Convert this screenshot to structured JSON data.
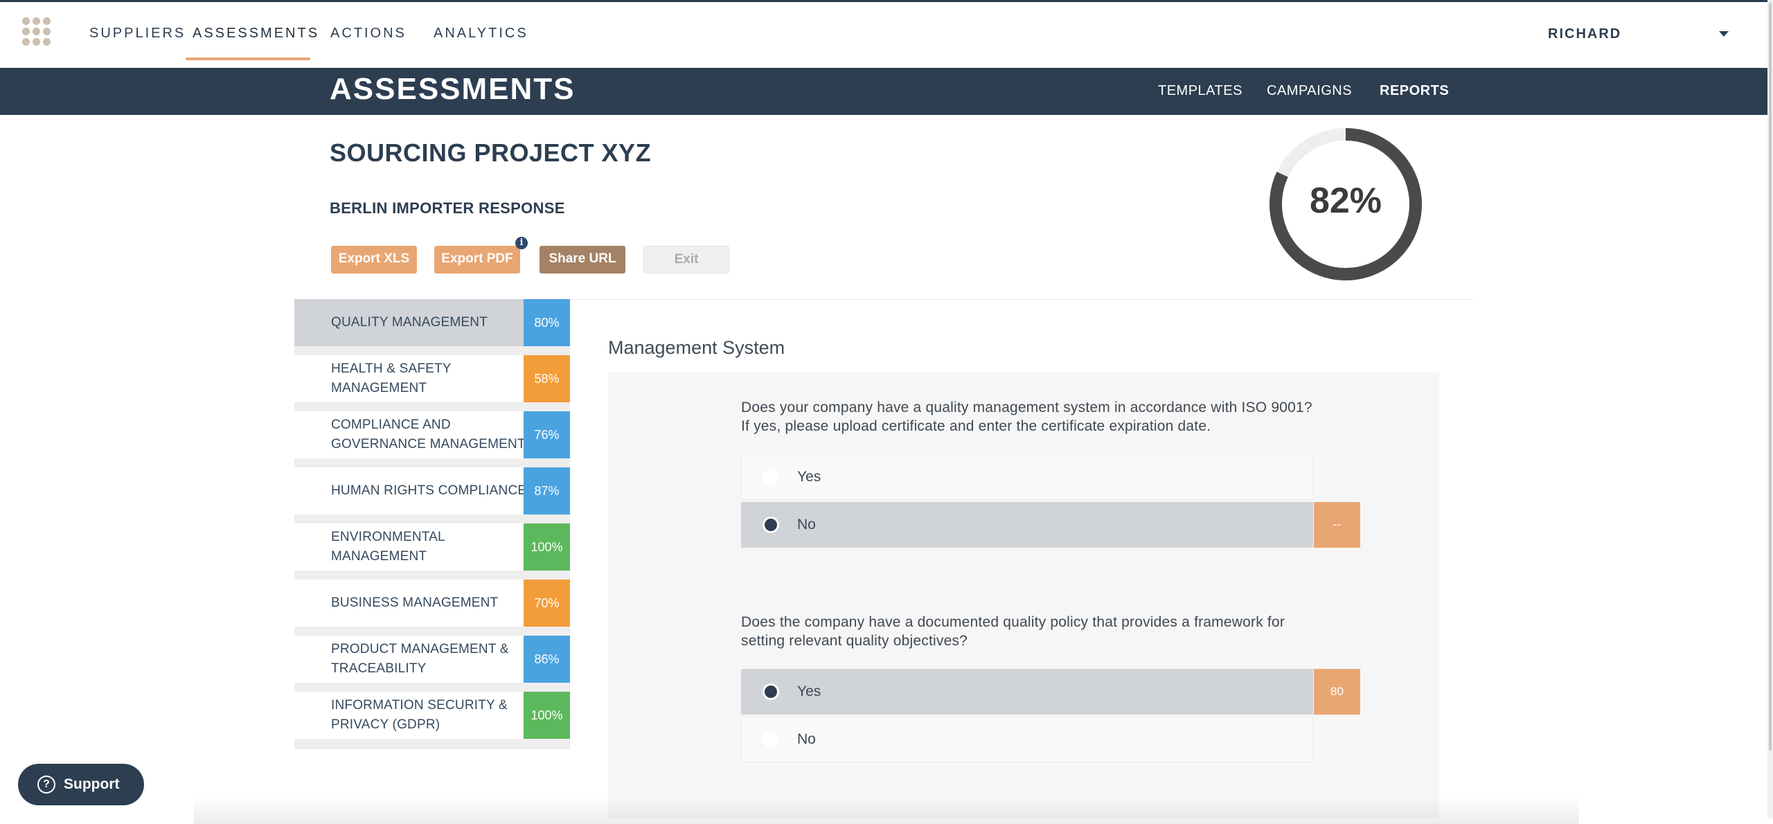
{
  "nav": {
    "items": [
      "SUPPLIERS",
      "ASSESSMENTS",
      "ACTIONS",
      "ANALYTICS"
    ],
    "active": "ASSESSMENTS",
    "user": "RICHARD",
    "accent": "#e8a673"
  },
  "subnav": {
    "title": "ASSESSMENTS",
    "links": [
      "TEMPLATES",
      "CAMPAIGNS",
      "REPORTS"
    ],
    "bg": "#2c3e50"
  },
  "report": {
    "project": "SOURCING PROJECT XYZ",
    "response": "BERLIN IMPORTER RESPONSE",
    "buttons": {
      "export_xls": "Export XLS",
      "export_pdf": "Export PDF",
      "share_url": "Share URL",
      "exit": "Exit"
    },
    "info_icon": "i",
    "overall_score": "82%",
    "overall_fraction": 0.82
  },
  "categories": [
    {
      "label": "QUALITY MANAGEMENT",
      "pct": "80%",
      "color": "#4aa3df",
      "active": true
    },
    {
      "label": "HEALTH & SAFETY MANAGEMENT",
      "pct": "58%",
      "color": "#f39c3a"
    },
    {
      "label": "COMPLIANCE AND GOVERNANCE MANAGEMENT",
      "pct": "76%",
      "color": "#4aa3df"
    },
    {
      "label": "HUMAN RIGHTS COMPLIANCE",
      "pct": "87%",
      "color": "#4aa3df"
    },
    {
      "label": "ENVIRONMENTAL MANAGEMENT",
      "pct": "100%",
      "color": "#5cb85c"
    },
    {
      "label": "BUSINESS MANAGEMENT",
      "pct": "70%",
      "color": "#f39c3a"
    },
    {
      "label": "PRODUCT MANAGEMENT & TRACEABILITY",
      "pct": "86%",
      "color": "#4aa3df"
    },
    {
      "label": "INFORMATION SECURITY & PRIVACY (GDPR)",
      "pct": "100%",
      "color": "#5cb85c"
    }
  ],
  "section": {
    "title": "Management System",
    "questions": [
      {
        "text": "Does your company have a quality management system in accordance with ISO 9001? If yes, please upload certificate and enter the certificate expiration date.",
        "options": [
          "Yes",
          "No"
        ],
        "selected": "No",
        "score": "--"
      },
      {
        "text": "Does the company have a documented quality policy that provides a framework for setting relevant quality objectives?",
        "options": [
          "Yes",
          "No"
        ],
        "selected": "Yes",
        "score": "80"
      }
    ]
  },
  "support": {
    "label": "Support",
    "icon": "?"
  }
}
